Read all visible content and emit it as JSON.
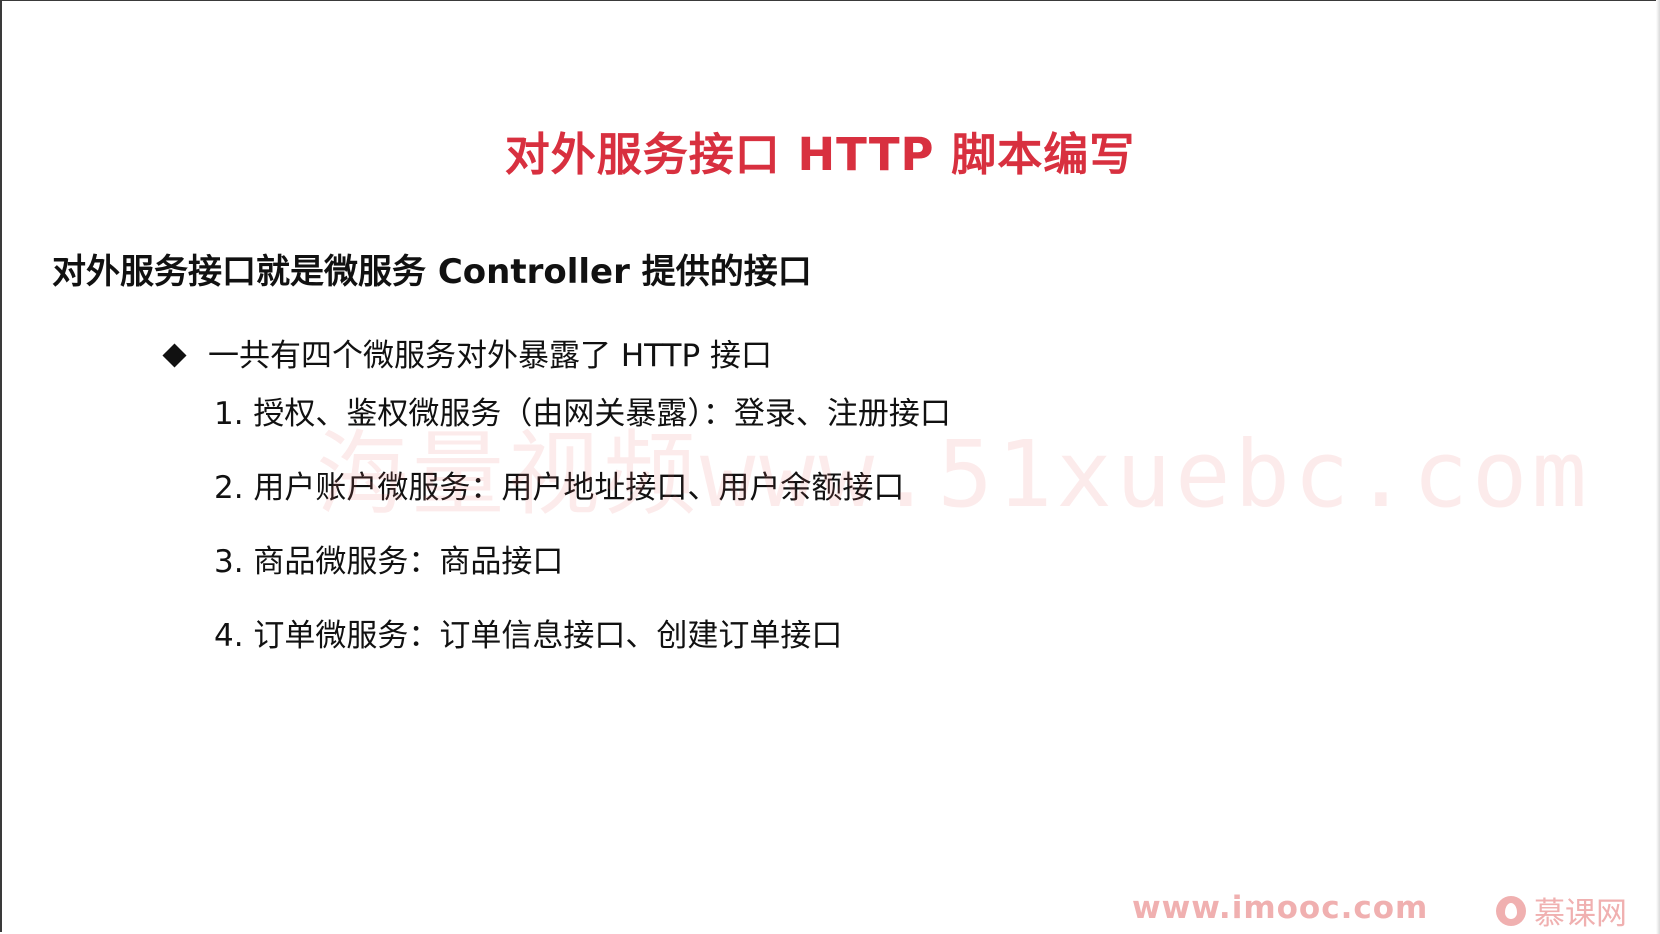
{
  "slide": {
    "title": "对外服务接口 HTTP 脚本编写",
    "heading": "对外服务接口就是微服务 Controller 提供的接口",
    "bullet": "一共有四个微服务对外暴露了 HTTP 接口",
    "items": [
      "1. 授权、鉴权微服务（由网关暴露）：登录、注册接口",
      "2. 用户账户微服务：用户地址接口、用户余额接口",
      "3. 商品微服务：商品接口",
      "4. 订单微服务：订单信息接口、创建订单接口"
    ]
  },
  "watermark": "海量视频www.51xuebc.com",
  "footer": {
    "site": "www.imooc.com",
    "logo_text": "慕课网"
  },
  "colors": {
    "title": "#d8303f",
    "text": "#111111",
    "footer": "#f0b0b0",
    "watermark": "#e86e6e"
  }
}
